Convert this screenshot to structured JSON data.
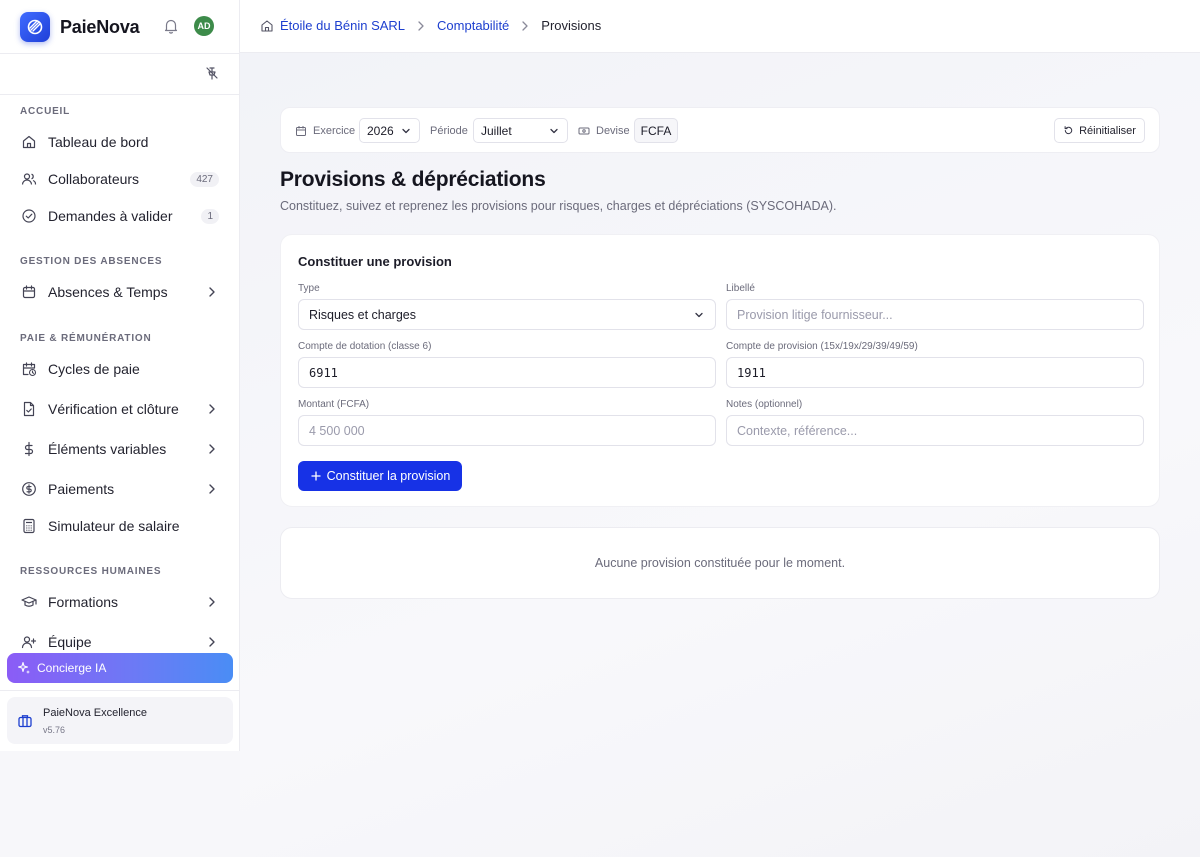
{
  "brand": {
    "name": "PaieNova",
    "avatar_initials": "AD"
  },
  "breadcrumb": {
    "company": "Étoile du Bénin SARL",
    "section": "Comptabilité",
    "current": "Provisions"
  },
  "sidebar": {
    "sections": {
      "accueil": "ACCUEIL",
      "absences": "GESTION DES ABSENCES",
      "paie": "PAIE & RÉMUNÉRATION",
      "rh": "RESSOURCES HUMAINES"
    },
    "items": {
      "tableau": {
        "label": "Tableau de bord"
      },
      "collaborateurs": {
        "label": "Collaborateurs",
        "badge": "427"
      },
      "demandes": {
        "label": "Demandes à valider",
        "badge": "1"
      },
      "absences": {
        "label": "Absences & Temps"
      },
      "cycles": {
        "label": "Cycles de paie"
      },
      "verification": {
        "label": "Vérification et clôture"
      },
      "elements": {
        "label": "Éléments variables"
      },
      "paiements": {
        "label": "Paiements"
      },
      "simulateur": {
        "label": "Simulateur de salaire"
      },
      "formations": {
        "label": "Formations"
      },
      "equipe": {
        "label": "Équipe"
      }
    },
    "concierge_label": "Concierge IA",
    "plan": {
      "name": "PaieNova Excellence",
      "version": "v5.76"
    }
  },
  "filters": {
    "exercice_label": "Exercice",
    "exercice_value": "2026",
    "periode_label": "Période",
    "periode_value": "Juillet",
    "devise_label": "Devise",
    "devise_value": "FCFA",
    "reset_label": "Réinitialiser"
  },
  "page": {
    "title": "Provisions & dépréciations",
    "subtitle": "Constituez, suivez et reprenez les provisions pour risques, charges et dépréciations (SYSCOHADA)."
  },
  "form": {
    "title": "Constituer une provision",
    "type_label": "Type",
    "type_value": "Risques et charges",
    "libelle_label": "Libellé",
    "libelle_placeholder": "Provision litige fournisseur...",
    "dotation_label": "Compte de dotation (classe 6)",
    "dotation_value": "6911",
    "provision_label": "Compte de provision (15x/19x/29/39/49/59)",
    "provision_value": "1911",
    "montant_label": "Montant (FCFA)",
    "montant_placeholder": "4 500 000",
    "notes_label": "Notes (optionnel)",
    "notes_placeholder": "Contexte, référence...",
    "submit_label": "Constituer la provision"
  },
  "empty_state": "Aucune provision constituée pour le moment.",
  "colors": {
    "accent": "#1732e6",
    "link": "#1d3fcf",
    "avatar": "#3d8b4a"
  }
}
